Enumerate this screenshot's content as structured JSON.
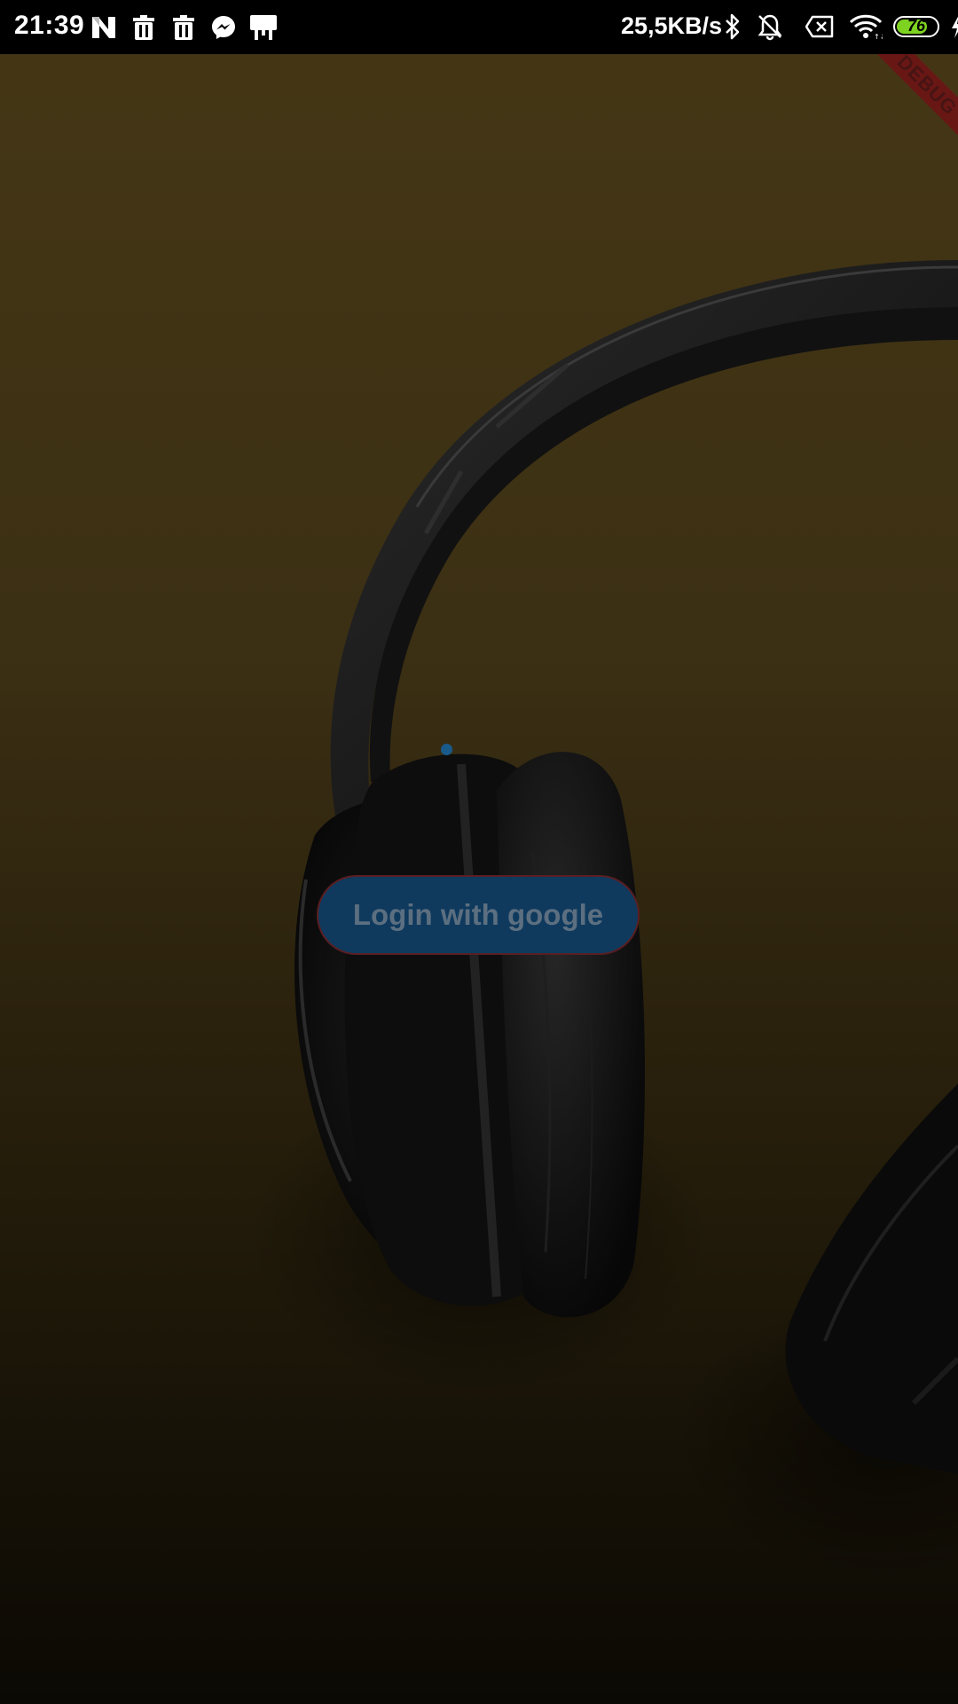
{
  "status_bar": {
    "time": "21:39",
    "network_speed": "25,5KB/s",
    "battery_level": "76",
    "battery_percent": 76,
    "left_icons": [
      "n-app-icon",
      "trash-icon",
      "trash-icon",
      "messenger-icon",
      "easel-icon"
    ],
    "right_icons": [
      "bluetooth-icon",
      "bell-muted-icon",
      "sim-off-icon",
      "wifi-icon",
      "battery-icon",
      "charging-bolt-icon"
    ]
  },
  "debug_banner": {
    "label": "DEBUG"
  },
  "login": {
    "button_label": "Login with google"
  },
  "colors": {
    "background_top": "#3f3214",
    "background_bottom": "#0b0904",
    "button_bg": "#0f3a5e",
    "button_border": "#5a1e22",
    "button_text": "#5c6f80",
    "battery_fill": "#7ed321"
  }
}
